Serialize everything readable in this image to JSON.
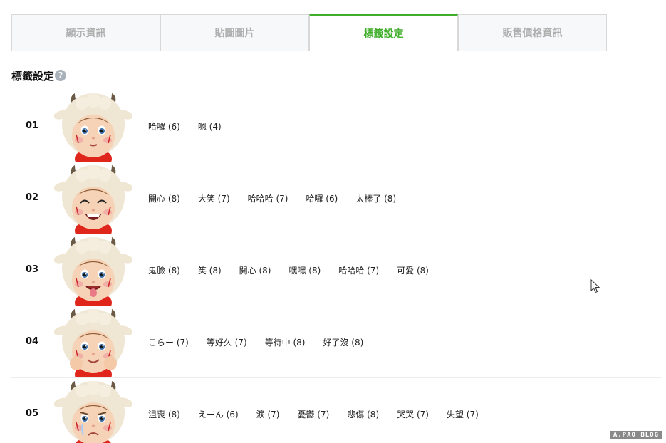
{
  "tabs": [
    {
      "label": "顯示資訊",
      "active": false
    },
    {
      "label": "貼圖圖片",
      "active": false
    },
    {
      "label": "標籤設定",
      "active": true
    },
    {
      "label": "販售價格資訊",
      "active": false
    }
  ],
  "section": {
    "title": "標籤設定",
    "help_icon": "question-icon"
  },
  "rows": [
    {
      "num": "01",
      "expression": "neutral",
      "tags": [
        "哈囉 (6)",
        "嗯 (4)"
      ]
    },
    {
      "num": "02",
      "expression": "laugh",
      "tags": [
        "開心 (8)",
        "大笑 (7)",
        "哈哈哈 (7)",
        "哈囉 (6)",
        "太棒了 (8)"
      ]
    },
    {
      "num": "03",
      "expression": "tongue",
      "tags": [
        "鬼臉 (8)",
        "笑 (8)",
        "開心 (8)",
        "嘿嘿 (8)",
        "哈哈哈 (7)",
        "可愛 (8)"
      ]
    },
    {
      "num": "04",
      "expression": "smile",
      "tags": [
        "こらー (7)",
        "等好久 (7)",
        "等待中 (8)",
        "好了沒 (8)"
      ]
    },
    {
      "num": "05",
      "expression": "sad",
      "tags": [
        "沮喪 (8)",
        "えーん (6)",
        "涙 (7)",
        "憂鬱 (7)",
        "悲傷 (8)",
        "哭哭 (7)",
        "失望 (7)"
      ]
    }
  ],
  "watermark": "A.PAO BLOG",
  "colors": {
    "accent": "#3fae2a",
    "tab_inactive_bg": "#f7f8f9",
    "tab_inactive_text": "#b0b0b0"
  }
}
